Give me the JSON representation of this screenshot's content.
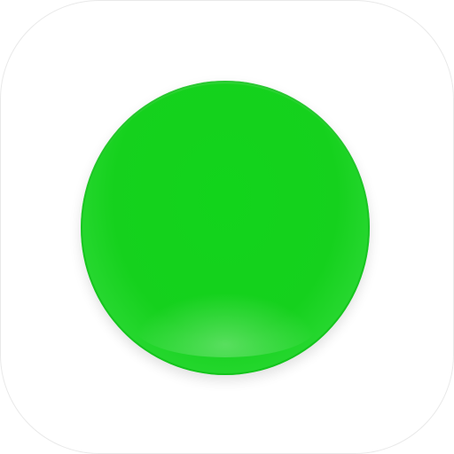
{
  "icon": {
    "name": "green-dot-app-icon",
    "accent_color": "#15d11d",
    "background_color": "#ffffff"
  }
}
